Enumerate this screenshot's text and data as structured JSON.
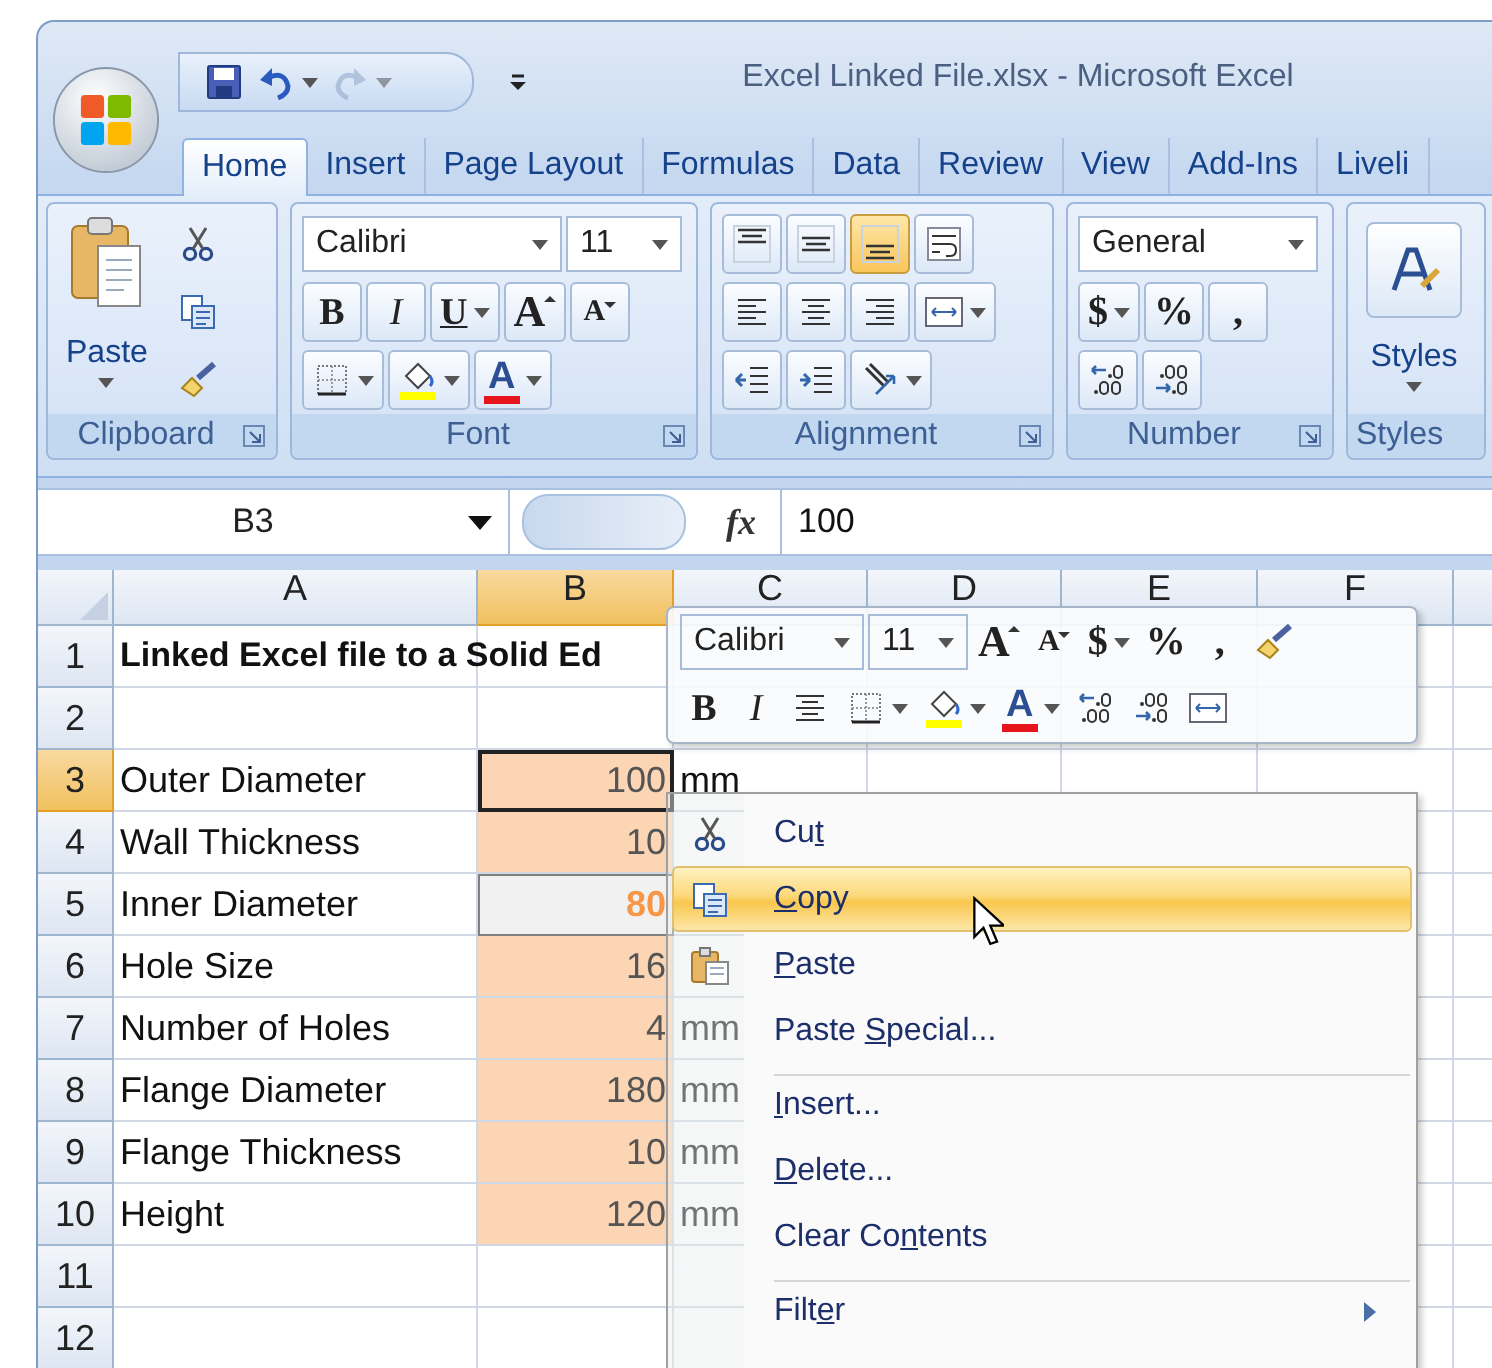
{
  "window": {
    "title": "Excel Linked File.xlsx - Microsoft Excel"
  },
  "quick_access": [
    {
      "kind": "save",
      "disabled": false,
      "dropdown": false
    },
    {
      "kind": "undo",
      "disabled": false,
      "dropdown": true
    },
    {
      "kind": "redo",
      "disabled": true,
      "dropdown": true
    }
  ],
  "tabs": [
    {
      "label": "Home",
      "selected": true
    },
    {
      "label": "Insert",
      "selected": false
    },
    {
      "label": "Page Layout",
      "selected": false
    },
    {
      "label": "Formulas",
      "selected": false
    },
    {
      "label": "Data",
      "selected": false
    },
    {
      "label": "Review",
      "selected": false
    },
    {
      "label": "View",
      "selected": false
    },
    {
      "label": "Add-Ins",
      "selected": false
    },
    {
      "label": "Liveli",
      "selected": false
    }
  ],
  "ribbon": {
    "groups": [
      {
        "label": "Clipboard",
        "launcher": true,
        "big": {
          "label": "Paste",
          "kind": "paste",
          "dropdown": true
        },
        "rows": [
          {
            "items": [
              {
                "kind": "cut",
                "dropdown": false
              }
            ]
          },
          {
            "items": [
              {
                "kind": "copy",
                "dropdown": false
              }
            ]
          },
          {
            "items": [
              {
                "kind": "painter",
                "dropdown": false
              }
            ]
          }
        ]
      },
      {
        "label": "Font",
        "launcher": true,
        "rows": [
          {
            "items": [
              {
                "kind": "font-name",
                "value": "Calibri"
              },
              {
                "kind": "font-size",
                "value": "11"
              }
            ]
          },
          {
            "items": [
              {
                "kind": "bold",
                "text": "B",
                "dropdown": false
              },
              {
                "kind": "italic",
                "text": "I",
                "dropdown": false
              },
              {
                "kind": "underline",
                "text": "U",
                "dropdown": true
              },
              {
                "kind": "grow",
                "text": "A",
                "dropdown": false
              },
              {
                "kind": "shrink",
                "text": "A",
                "dropdown": false
              }
            ]
          },
          {
            "items": [
              {
                "kind": "border",
                "dropdown": true
              },
              {
                "kind": "fill",
                "dropdown": true
              },
              {
                "kind": "font-color",
                "text": "A",
                "dropdown": true
              }
            ]
          }
        ]
      },
      {
        "label": "Alignment",
        "launcher": true,
        "rows": [
          {
            "items": [
              {
                "kind": "align-top",
                "dropdown": false,
                "selected": false
              },
              {
                "kind": "align-middle",
                "dropdown": false,
                "selected": false
              },
              {
                "kind": "align-bottom",
                "dropdown": false,
                "selected": true
              },
              {
                "kind": "wrap",
                "dropdown": false,
                "selected": false
              }
            ]
          },
          {
            "items": [
              {
                "kind": "align-left",
                "dropdown": false,
                "selected": false
              },
              {
                "kind": "align-center",
                "dropdown": false,
                "selected": false
              },
              {
                "kind": "align-right",
                "dropdown": false,
                "selected": false
              },
              {
                "kind": "merge",
                "dropdown": true,
                "selected": false
              }
            ]
          },
          {
            "items": [
              {
                "kind": "indent-dec",
                "dropdown": false,
                "selected": false
              },
              {
                "kind": "indent-inc",
                "dropdown": false,
                "selected": false
              },
              {
                "kind": "orientation",
                "dropdown": true,
                "selected": false
              }
            ]
          }
        ]
      },
      {
        "label": "Number",
        "launcher": true,
        "rows": [
          {
            "items": [
              {
                "kind": "number-format",
                "value": "General"
              }
            ]
          },
          {
            "items": [
              {
                "kind": "currency",
                "text": "$",
                "dropdown": true
              },
              {
                "kind": "percent",
                "text": "%",
                "dropdown": false
              },
              {
                "kind": "comma",
                "text": ",",
                "dropdown": false
              }
            ]
          },
          {
            "items": [
              {
                "kind": "inc-decimal",
                "dropdown": false
              },
              {
                "kind": "dec-decimal",
                "dropdown": false
              }
            ]
          }
        ]
      },
      {
        "label": "Styles",
        "launcher": false,
        "big": {
          "label": "Styles",
          "kind": "styles",
          "dropdown": true
        }
      }
    ]
  },
  "formula_bar": {
    "name_box": "B3",
    "fx": "fx",
    "value": "100"
  },
  "columns": [
    {
      "label": "A",
      "selected": false
    },
    {
      "label": "B",
      "selected": true
    },
    {
      "label": "C",
      "selected": false
    },
    {
      "label": "D",
      "selected": false
    },
    {
      "label": "E",
      "selected": false
    },
    {
      "label": "F",
      "selected": false
    }
  ],
  "rows": [
    {
      "header": "1",
      "kind": "title",
      "a": "Linked Excel file to a Solid Ed",
      "selected": false
    },
    {
      "header": "2",
      "kind": "empty",
      "selected": false
    },
    {
      "header": "3",
      "kind": "data",
      "a": "Outer Diameter",
      "b": "100",
      "c": "mm",
      "calculated": false,
      "selected": true
    },
    {
      "header": "4",
      "kind": "data",
      "a": "Wall Thickness",
      "b": "10",
      "calculated": false,
      "selected": false
    },
    {
      "header": "5",
      "kind": "data",
      "a": "Inner Diameter",
      "b": "80",
      "calculated": true,
      "selected": false
    },
    {
      "header": "6",
      "kind": "data",
      "a": "Hole Size",
      "b": "16",
      "calculated": false,
      "selected": false
    },
    {
      "header": "7",
      "kind": "data",
      "a": "Number of Holes",
      "b": "4",
      "c": "mm",
      "calculated": false,
      "selected": false
    },
    {
      "header": "8",
      "kind": "data",
      "a": "Flange Diameter",
      "b": "180",
      "c": "mm",
      "calculated": false,
      "selected": false
    },
    {
      "header": "9",
      "kind": "data",
      "a": "Flange Thickness",
      "b": "10",
      "c": "mm",
      "calculated": false,
      "selected": false
    },
    {
      "header": "10",
      "kind": "data",
      "a": "Height",
      "b": "120",
      "c": "mm",
      "calculated": false,
      "selected": false
    },
    {
      "header": "11",
      "kind": "empty",
      "selected": false
    },
    {
      "header": "12",
      "kind": "empty",
      "selected": false
    }
  ],
  "mini_toolbar": {
    "rows": [
      {
        "items": [
          {
            "kind": "font-name",
            "value": "Calibri"
          },
          {
            "kind": "font-size",
            "value": "11"
          },
          {
            "kind": "grow",
            "text": "A",
            "dropdown": false
          },
          {
            "kind": "shrink",
            "text": "A",
            "dropdown": false
          },
          {
            "kind": "currency",
            "text": "$",
            "dropdown": true
          },
          {
            "kind": "percent",
            "text": "%",
            "dropdown": false
          },
          {
            "kind": "comma",
            "text": ",",
            "dropdown": false
          },
          {
            "kind": "painter",
            "dropdown": false
          }
        ]
      },
      {
        "items": [
          {
            "kind": "bold",
            "text": "B",
            "dropdown": false
          },
          {
            "kind": "italic",
            "text": "I",
            "dropdown": false
          },
          {
            "kind": "align-center",
            "dropdown": false
          },
          {
            "kind": "border",
            "dropdown": true
          },
          {
            "kind": "fill",
            "dropdown": true
          },
          {
            "kind": "font-color",
            "text": "A",
            "dropdown": true
          },
          {
            "kind": "inc-decimal",
            "dropdown": false
          },
          {
            "kind": "dec-decimal",
            "dropdown": false
          },
          {
            "kind": "merge",
            "dropdown": false
          }
        ]
      }
    ]
  },
  "context_menu": {
    "items": [
      {
        "kind": "cut",
        "pre": "Cu",
        "key": "t",
        "selected": false,
        "submenu": false,
        "separator_before": false
      },
      {
        "kind": "copy",
        "key": "C",
        "post": "opy",
        "selected": true,
        "submenu": false,
        "separator_before": false
      },
      {
        "kind": "paste",
        "key": "P",
        "post": "aste",
        "selected": false,
        "submenu": false,
        "separator_before": false
      },
      {
        "kind": "plain",
        "pre": "Paste ",
        "key": "S",
        "post": "pecial...",
        "selected": false,
        "submenu": false,
        "separator_before": false
      },
      {
        "kind": "plain",
        "key": "I",
        "post": "nsert...",
        "selected": false,
        "submenu": false,
        "separator_before": true
      },
      {
        "kind": "plain",
        "key": "D",
        "post": "elete...",
        "selected": false,
        "submenu": false,
        "separator_before": false
      },
      {
        "kind": "plain",
        "pre": "Clear Co",
        "key": "n",
        "post": "tents",
        "selected": false,
        "submenu": false,
        "separator_before": false
      },
      {
        "kind": "plain",
        "pre": "Filt",
        "key": "e",
        "post": "r",
        "selected": false,
        "submenu": true,
        "separator_before": true
      }
    ]
  }
}
